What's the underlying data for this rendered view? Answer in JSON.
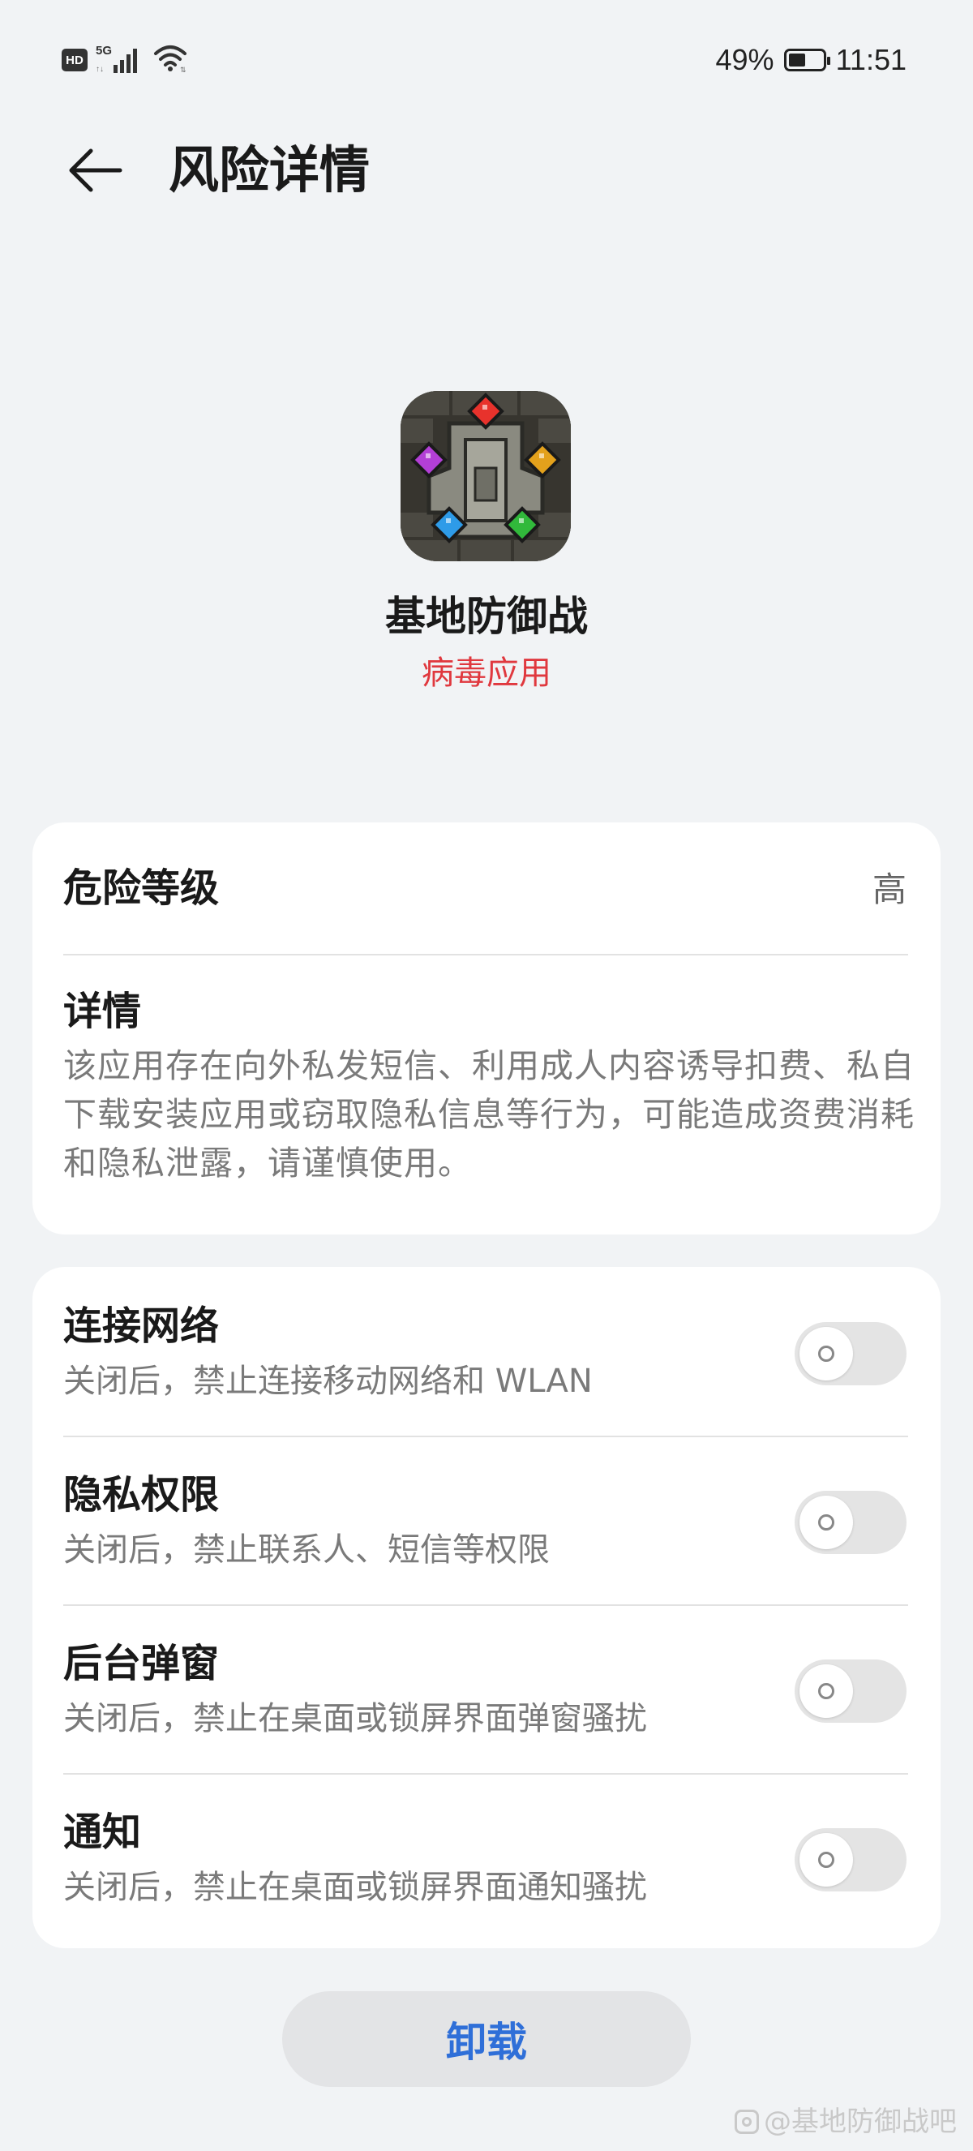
{
  "status_bar": {
    "hd": "HD",
    "network": "5G",
    "battery_percent": "49%",
    "battery_level": 0.49,
    "time": "11:51",
    "icons": [
      "hd-icon",
      "5g-signal-icon",
      "wifi-icon",
      "battery-icon"
    ]
  },
  "header": {
    "back_icon": "arrow-left-icon",
    "title": "风险详情"
  },
  "app": {
    "icon": "app-icon-base-defense",
    "name": "基地防御战",
    "status": "病毒应用",
    "status_color": "#e0383e"
  },
  "risk": {
    "level_label": "危险等级",
    "level_value": "高",
    "details_title": "详情",
    "details_text": "该应用存在向外私发短信、利用成人内容诱导扣费、私自下载安装应用或窃取隐私信息等行为，可能造成资费消耗和隐私泄露，请谨慎使用。"
  },
  "permissions": [
    {
      "title": "连接网络",
      "desc": "关闭后，禁止连接移动网络和 WLAN",
      "enabled": false
    },
    {
      "title": "隐私权限",
      "desc": "关闭后，禁止联系人、短信等权限",
      "enabled": false
    },
    {
      "title": "后台弹窗",
      "desc": "关闭后，禁止在桌面或锁屏界面弹窗骚扰",
      "enabled": false
    },
    {
      "title": "通知",
      "desc": "关闭后，禁止在桌面或锁屏界面通知骚扰",
      "enabled": false
    }
  ],
  "actions": {
    "uninstall_label": "卸载",
    "uninstall_color": "#2f6fd8"
  },
  "watermark": {
    "text": "@基地防御战吧"
  }
}
